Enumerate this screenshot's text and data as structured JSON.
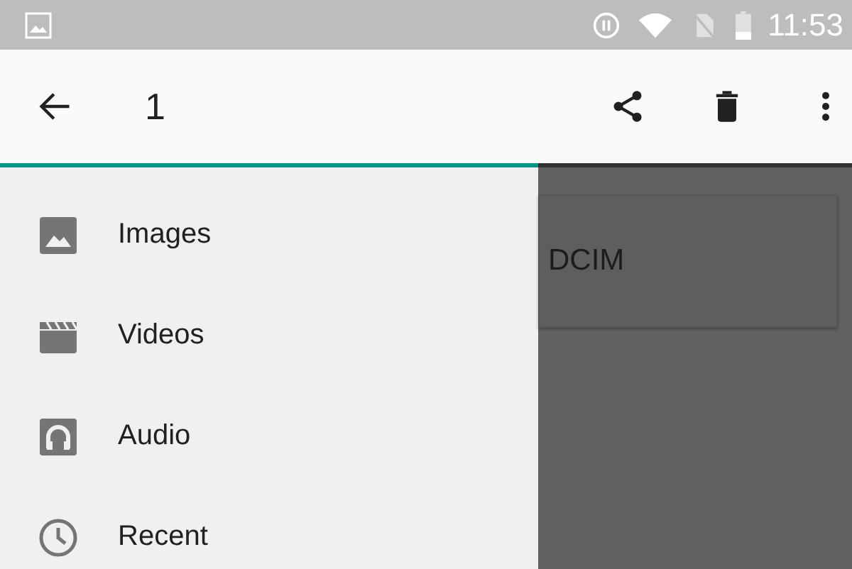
{
  "status_bar": {
    "time": "11:53"
  },
  "toolbar": {
    "title": "1"
  },
  "drawer": {
    "items": [
      {
        "kind": "images",
        "label": "Images"
      },
      {
        "kind": "videos",
        "label": "Videos"
      },
      {
        "kind": "audio",
        "label": "Audio"
      },
      {
        "kind": "recent",
        "label": "Recent"
      }
    ]
  },
  "folders": [
    {
      "name": "DCIM"
    }
  ]
}
